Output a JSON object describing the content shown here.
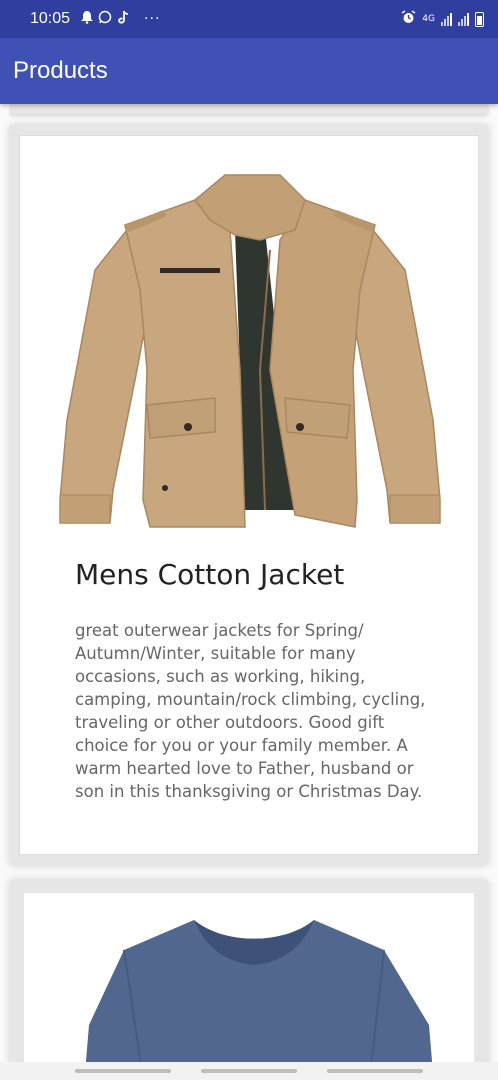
{
  "status_bar": {
    "time": "10:05",
    "app_icons": [
      "bell-icon",
      "whatsapp-icon",
      "tiktok-icon"
    ],
    "more_indicator": "···",
    "network_label": "4G",
    "icons": [
      "alarm-icon",
      "signal-icon",
      "signal-icon",
      "battery-icon"
    ]
  },
  "app_bar": {
    "title": "Products"
  },
  "products": [
    {
      "title": "Mens Cotton Jacket",
      "description": "great outerwear jackets for Spring/ Autumn/Winter, suitable for many occasions, such as working, hiking, camping, mountain/rock climbing, cycling, traveling or other outdoors. Good gift choice for you or your family member. A warm hearted love to Father, husband or son in this thanksgiving or Christmas Day.",
      "image": "khaki-jacket-image",
      "colors": {
        "jacket": "#c9a77e",
        "lining": "#2f352f"
      }
    },
    {
      "image": "blue-tshirt-image",
      "colors": {
        "shirt": "#52678f"
      }
    }
  ]
}
